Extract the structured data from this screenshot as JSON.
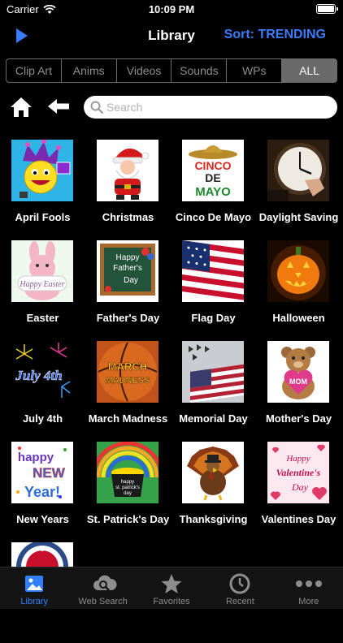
{
  "status_bar": {
    "carrier": "Carrier",
    "time": "10:09 PM"
  },
  "nav": {
    "title": "Library",
    "sort_label": "Sort: TRENDING",
    "accent": "#3a7bff"
  },
  "segments": [
    "Clip Art",
    "Anims",
    "Videos",
    "Sounds",
    "WPs",
    "ALL"
  ],
  "selected_segment": "ALL",
  "search": {
    "placeholder": "Search",
    "value": ""
  },
  "grid": {
    "items": [
      {
        "label": "April Fools",
        "icon": "jester-smiley"
      },
      {
        "label": "Christmas",
        "icon": "santa"
      },
      {
        "label": "Cinco De Mayo",
        "icon": "sombrero-cinco-de-mayo"
      },
      {
        "label": "Daylight Saving",
        "icon": "clock"
      },
      {
        "label": "Easter",
        "icon": "easter-bunny"
      },
      {
        "label": "Father's Day",
        "icon": "chalkboard"
      },
      {
        "label": "Flag Day",
        "icon": "us-flag"
      },
      {
        "label": "Halloween",
        "icon": "jack-o-lantern"
      },
      {
        "label": "July 4th",
        "icon": "fireworks"
      },
      {
        "label": "March Madness",
        "icon": "basketball"
      },
      {
        "label": "Memorial Day",
        "icon": "flag-jets"
      },
      {
        "label": "Mother's Day",
        "icon": "teddy-bear-heart"
      },
      {
        "label": "New Years",
        "icon": "happy-new-year"
      },
      {
        "label": "St. Patrick's Day",
        "icon": "pot-of-gold"
      },
      {
        "label": "Thanksgiving",
        "icon": "turkey"
      },
      {
        "label": "Valentines Day",
        "icon": "hearts"
      },
      {
        "label": "",
        "icon": "remember-badge"
      }
    ],
    "thumb_texts": {
      "cinco": [
        "CINCO",
        "DE",
        "MAYO"
      ],
      "easter": "Happy Easter",
      "fathers": [
        "Happy",
        "Father's",
        "Day"
      ],
      "july": "July 4th",
      "march": [
        "MARCH",
        "MADNESS"
      ],
      "mom": "MOM",
      "newyear": [
        "happy",
        "NEW",
        "Year!"
      ],
      "patrick": [
        "happy",
        "st. patrick's",
        "day"
      ],
      "valentine": [
        "Happy",
        "Valentine's",
        "Day"
      ]
    }
  },
  "tabs": [
    {
      "label": "Library",
      "icon": "picture-icon",
      "active": true
    },
    {
      "label": "Web Search",
      "icon": "cloud-search-icon",
      "active": false
    },
    {
      "label": "Favorites",
      "icon": "star-icon",
      "active": false
    },
    {
      "label": "Recent",
      "icon": "clock-icon",
      "active": false
    },
    {
      "label": "More",
      "icon": "ellipsis-icon",
      "active": false
    }
  ]
}
